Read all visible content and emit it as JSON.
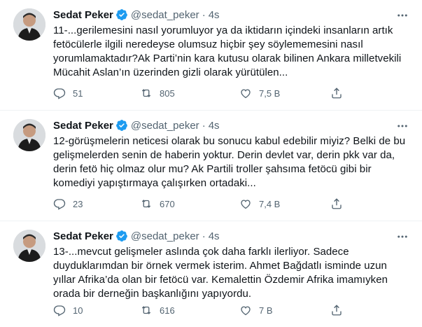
{
  "tweets": [
    {
      "name": "Sedat Peker",
      "handle": "@sedat_peker",
      "dot": "·",
      "time": "4s",
      "lines": [
        "11-...gerilemesini nasıl yorumluyor ya da iktidarın içindeki insanların artık",
        "fetöcülerle ilgili neredeyse olumsuz hiçbir şey söylememesini nasıl",
        "yorumlamaktadır?Ak Parti’nin kara kutusu olarak bilinen Ankara milletvekili",
        "Mücahit Aslan’ın üzerinden gizli olarak yürütülen..."
      ],
      "replies": "51",
      "retweets": "805",
      "likes": "7,5 B"
    },
    {
      "name": "Sedat Peker",
      "handle": "@sedat_peker",
      "dot": "·",
      "time": "4s",
      "lines": [
        "12-görüşmelerin neticesi olarak bu sonucu kabul edebilir miyiz? Belki de bu",
        "gelişmelerden senin de haberin yoktur. Derin devlet var, derin pkk var da,",
        "derin fetö hiç olmaz olur mu? Ak Partili troller şahsıma fetöcü gibi bir",
        "komediyi yapıştırmaya çalışırken ortadaki..."
      ],
      "replies": "23",
      "retweets": "670",
      "likes": "7,4 B"
    },
    {
      "name": "Sedat Peker",
      "handle": "@sedat_peker",
      "dot": "·",
      "time": "4s",
      "lines": [
        "13-...mevcut gelişmeler aslında çok daha farklı ilerliyor. Sadece",
        "duyduklarımdan bir örnek vermek isterim. Ahmet Bağdatlı isminde uzun",
        "yıllar Afrika’da olan bir fetöcü var. Kemalettin Özdemir Afrika imamıyken",
        "orada bir derneğin başkanlığını yapıyordu."
      ],
      "replies": "10",
      "retweets": "616",
      "likes": "7 B"
    }
  ],
  "icons": {
    "verified": "verified-badge-icon",
    "more": "more-options-icon",
    "reply": "reply-icon",
    "retweet": "retweet-icon",
    "like": "like-icon",
    "share": "share-icon"
  },
  "colors": {
    "verified": "#1d9bf0",
    "secondary_text": "#536471",
    "primary_text": "#0f1419",
    "divider": "#eff3f4"
  }
}
